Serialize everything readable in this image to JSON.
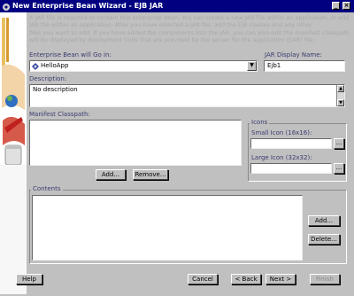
{
  "window": {
    "title": "New Enterprise Bean Wizard - EJB JAR"
  },
  "intro": [
    "A JAR file is required to contain this enterprise bean. You can create a new JAR file within an application, or add this bean to an existing",
    "JAR file within an application. After you have selected a JAR file, add the EJB classes and any other",
    "files you want to add. If you have added the components into the JAR, you can also edit the manifest classpath. The icons",
    "will be displayed by deployment tools that are provided by the server for the application (EAR) file."
  ],
  "form": {
    "enterprise_bean_label": "Enterprise Bean will Go in:",
    "enterprise_bean_value": "HelloApp",
    "jar_display_name_label": "JAR Display Name:",
    "jar_display_name_value": "Ejb1",
    "description_label": "Description:",
    "description_value": "No description",
    "manifest_label": "Manifest Classpath:",
    "add_label": "Add...",
    "remove_label": "Remove...",
    "icons_label": "Icons",
    "small_icon_label": "Small Icon (16x16):",
    "large_icon_label": "Large Icon (32x32):",
    "browse_label": "...",
    "contents_label": "Contents",
    "contents_add_label": "Add...",
    "contents_delete_label": "Delete..."
  },
  "footer": {
    "help_label": "Help",
    "cancel_label": "Cancel",
    "back_label": "< Back",
    "next_label": "Next >",
    "finish_label": "Finish"
  },
  "colors": {
    "titlebar": "#000080",
    "face": "#c0c0c0",
    "label": "#3a3a70"
  }
}
